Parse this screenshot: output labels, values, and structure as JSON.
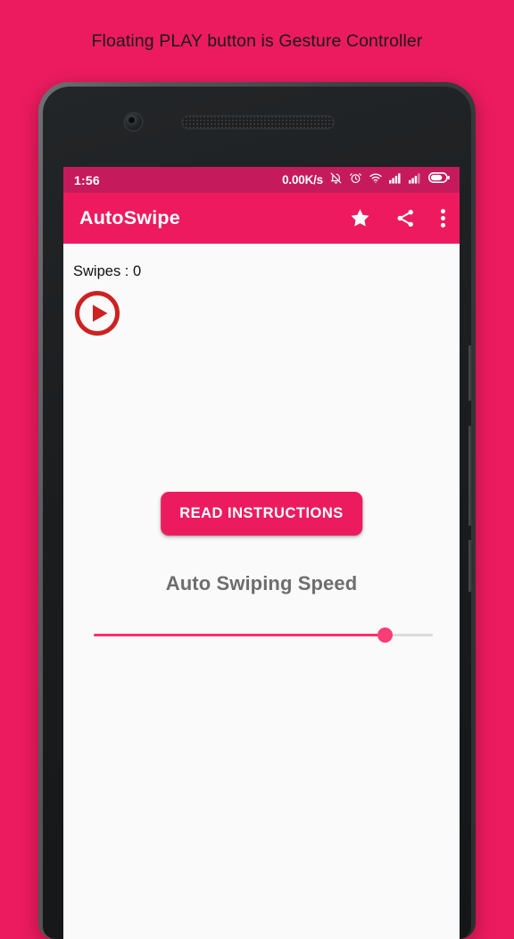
{
  "promo": {
    "caption": "Floating PLAY button is Gesture Controller",
    "background_color": "#ec1b5f",
    "text_color": "#1b1b1b"
  },
  "device": {
    "camera_icon": "front-camera",
    "speaker_icon": "earpiece-speaker"
  },
  "status_bar": {
    "clock": "1:56",
    "network_speed": "0.00K/s",
    "icons": [
      "bell-muted-icon",
      "alarm-clock-icon",
      "wifi-icon",
      "signal-bars-icon",
      "signal-bars-secondary-icon",
      "battery-icon"
    ],
    "battery_level": 75,
    "background_color": "#c51a5b"
  },
  "app_bar": {
    "title": "AutoSwipe",
    "background_color": "#ed1a5f",
    "actions": [
      {
        "name": "favorite",
        "icon": "star-icon"
      },
      {
        "name": "share",
        "icon": "share-icon"
      },
      {
        "name": "overflow",
        "icon": "more-vertical-icon"
      }
    ]
  },
  "content": {
    "swipes_label": "Swipes : 0",
    "swipes_count": 0,
    "play_button": {
      "icon": "play-circle-icon",
      "color": "#cc2222"
    },
    "read_instructions_label": "READ INSTRUCTIONS",
    "speed_heading": "Auto Swiping Speed",
    "speed_slider": {
      "value_percent": 86,
      "min": 0,
      "max": 100,
      "active_color": "#f62f6e",
      "track_color": "#dcdcdc"
    },
    "background_color": "#fafafa"
  }
}
